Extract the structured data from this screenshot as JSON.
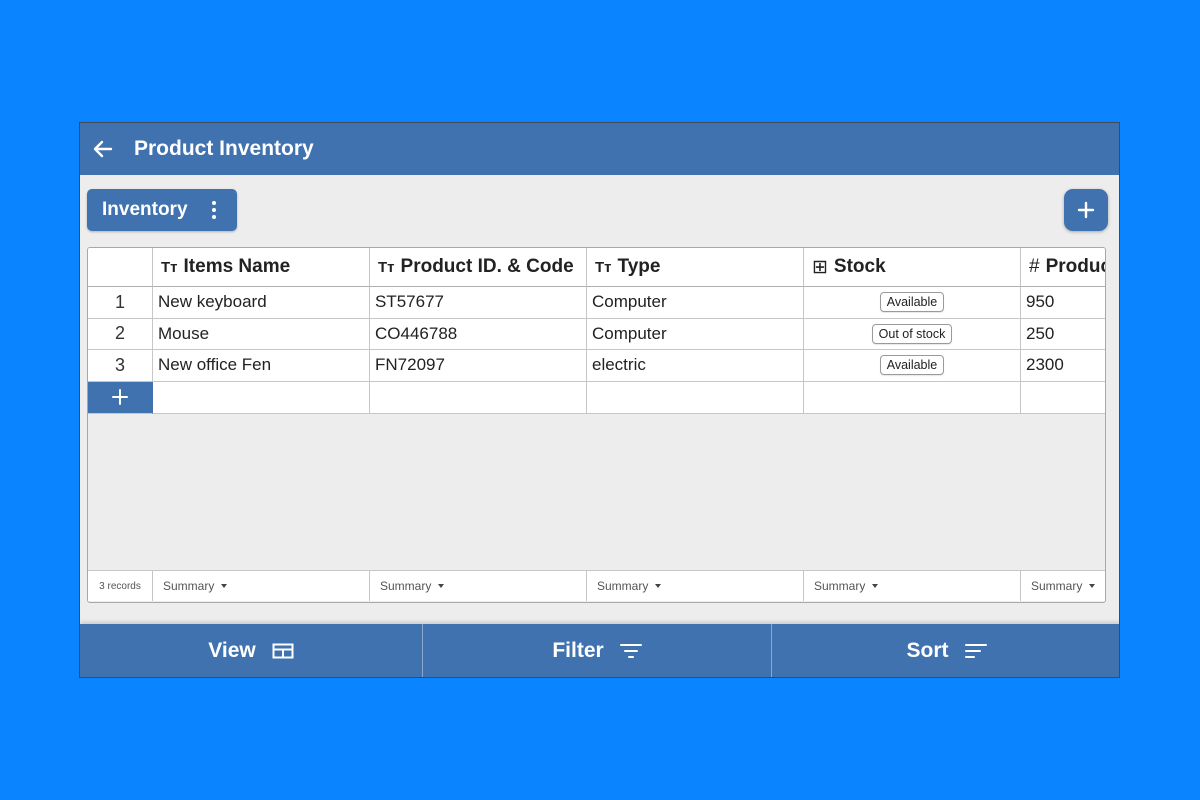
{
  "header": {
    "title": "Product Inventory",
    "back_icon": "arrow-left-icon"
  },
  "toolbar": {
    "view_button_label": "Inventory",
    "menu_icon": "kebab-icon",
    "add_icon": "plus-icon"
  },
  "table": {
    "columns": [
      {
        "icon": "Tт",
        "label": "Items Name"
      },
      {
        "icon": "Tт",
        "label": "Product ID. & Code"
      },
      {
        "icon": "Tт",
        "label": "Type"
      },
      {
        "icon": "⊞",
        "label": "Stock"
      },
      {
        "icon": "#",
        "label": "Product"
      }
    ],
    "rows": [
      {
        "num": "1",
        "name": "New keyboard",
        "code": "ST57677",
        "type": "Computer",
        "stock": "Available",
        "qty": "950"
      },
      {
        "num": "2",
        "name": "Mouse",
        "code": "CO446788",
        "type": "Computer",
        "stock": "Out of stock",
        "qty": "250"
      },
      {
        "num": "3",
        "name": "New office Fen",
        "code": "FN72097",
        "type": "electric",
        "stock": "Available",
        "qty": "2300"
      }
    ],
    "add_row_icon": "+",
    "footer": {
      "records": "3 records",
      "summary_label": "Summary"
    }
  },
  "bottom_bar": {
    "view_label": "View",
    "filter_label": "Filter",
    "sort_label": "Sort"
  },
  "colors": {
    "accent": "#3f72af",
    "background": "#0a84ff",
    "panel": "#ededed"
  }
}
